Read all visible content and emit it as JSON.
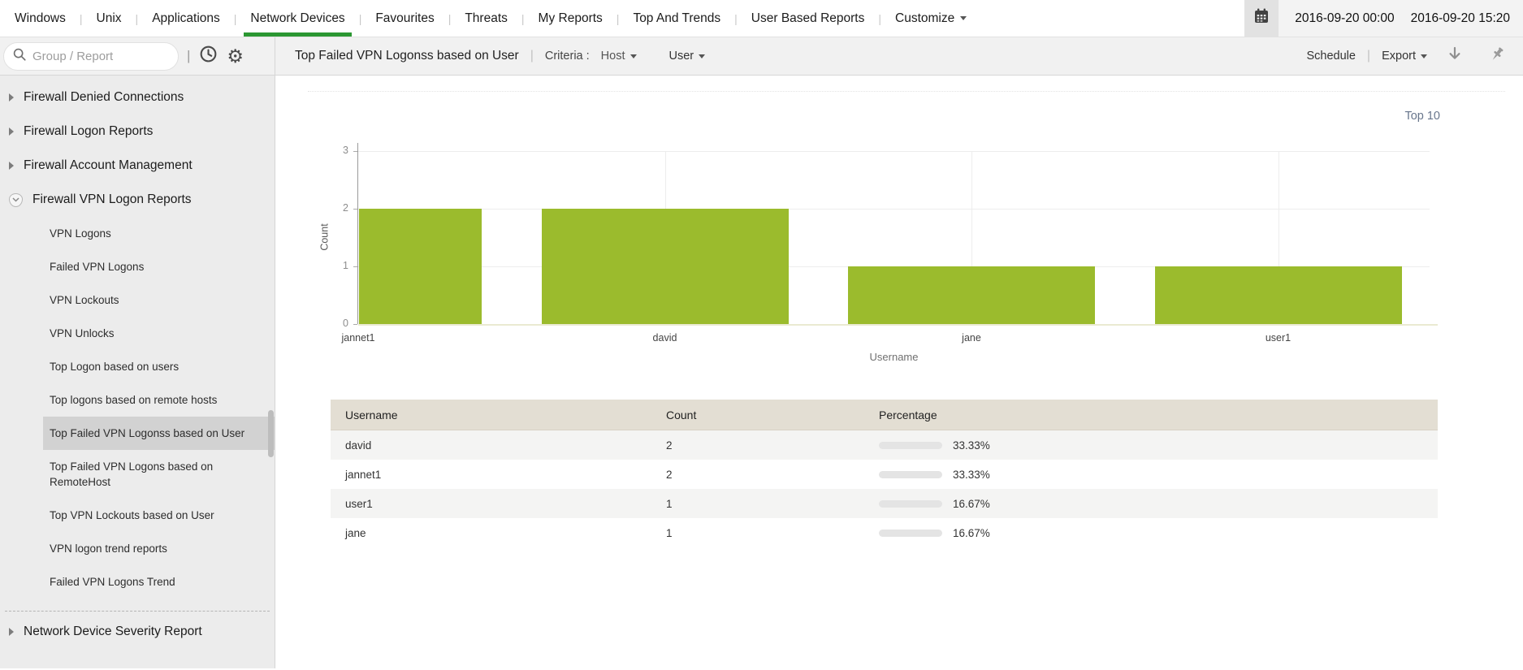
{
  "nav": {
    "tabs": [
      {
        "label": "Windows",
        "active": false
      },
      {
        "label": "Unix",
        "active": false
      },
      {
        "label": "Applications",
        "active": false
      },
      {
        "label": "Network Devices",
        "active": true
      },
      {
        "label": "Favourites",
        "active": false
      },
      {
        "label": "Threats",
        "active": false
      },
      {
        "label": "My Reports",
        "active": false
      },
      {
        "label": "Top And Trends",
        "active": false
      },
      {
        "label": "User Based Reports",
        "active": false
      },
      {
        "label": "Customize",
        "active": false,
        "dropdown": true
      }
    ],
    "date_start": "2016-09-20 00:00",
    "date_end": "2016-09-20 15:20"
  },
  "sidebar": {
    "search_placeholder": "Group / Report",
    "groups": [
      {
        "label": "Firewall Denied Connections",
        "expanded": false
      },
      {
        "label": "Firewall Logon Reports",
        "expanded": false
      },
      {
        "label": "Firewall Account Management",
        "expanded": false
      },
      {
        "label": "Firewall VPN Logon Reports",
        "expanded": true,
        "children": [
          {
            "label": "VPN Logons"
          },
          {
            "label": "Failed VPN Logons"
          },
          {
            "label": "VPN Lockouts"
          },
          {
            "label": "VPN Unlocks"
          },
          {
            "label": "Top Logon based on users"
          },
          {
            "label": "Top logons based on remote hosts"
          },
          {
            "label": "Top Failed VPN Logonss based on User",
            "selected": true
          },
          {
            "label": "Top Failed VPN Logons based on RemoteHost"
          },
          {
            "label": "Top VPN Lockouts based on User"
          },
          {
            "label": "VPN logon trend reports"
          },
          {
            "label": "Failed VPN Logons Trend"
          }
        ]
      },
      {
        "label": "Network Device Severity Report",
        "expanded": false,
        "divider_before": true
      }
    ]
  },
  "toolbar": {
    "title": "Top Failed VPN Logonss based on User",
    "criteria_label": "Criteria :",
    "criteria_host": "Host",
    "criteria_user": "User",
    "schedule_label": "Schedule",
    "export_label": "Export"
  },
  "report": {
    "top_label": "Top 10"
  },
  "chart_data": {
    "type": "bar",
    "title": "Top 10",
    "categories": [
      "jannet1",
      "david",
      "jane",
      "user1"
    ],
    "values": [
      2,
      2,
      1,
      1
    ],
    "xlabel": "Username",
    "ylabel": "Count",
    "ylim": [
      0,
      3
    ],
    "yticks": [
      0,
      1,
      2,
      3
    ],
    "grid": true,
    "legend": false,
    "bar_color": "#9bbb2d"
  },
  "table": {
    "columns": [
      "Username",
      "Count",
      "Percentage"
    ],
    "rows": [
      {
        "username": "david",
        "count": "2",
        "percentage": "33.33%",
        "pct": 33.33
      },
      {
        "username": "jannet1",
        "count": "2",
        "percentage": "33.33%",
        "pct": 33.33
      },
      {
        "username": "user1",
        "count": "1",
        "percentage": "16.67%",
        "pct": 16.67
      },
      {
        "username": "jane",
        "count": "1",
        "percentage": "16.67%",
        "pct": 16.67
      }
    ]
  },
  "colors": {
    "accent_green": "#2b9732",
    "bar_green": "#9bbb2d",
    "table_header_bg": "#e3ded3",
    "selected_item_bg": "#d2d2d2"
  }
}
